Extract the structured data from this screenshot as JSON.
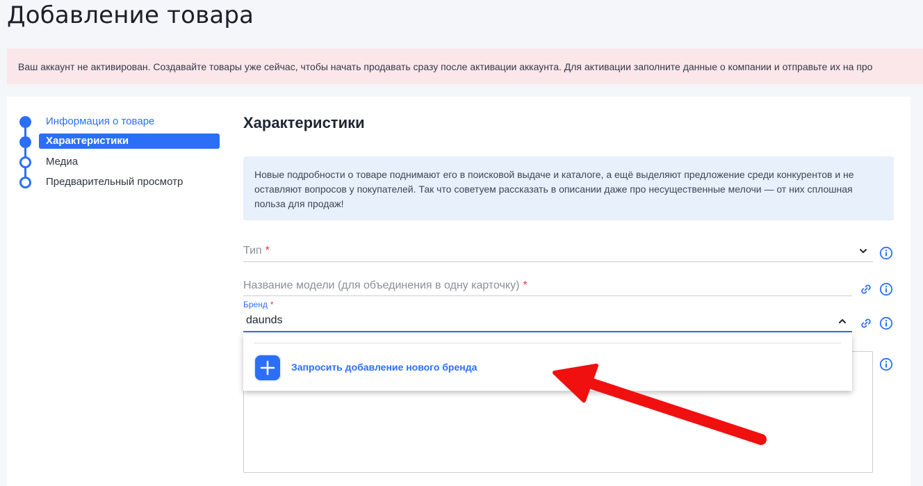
{
  "page": {
    "title": "Добавление товара"
  },
  "banner": {
    "text": "Ваш аккаунт не активирован. Создавайте товары уже сейчас, чтобы начать продавать сразу после активации аккаунта. Для активации заполните данные о компании и отправьте их на про"
  },
  "stepper": {
    "steps": [
      {
        "label": "Информация о товаре",
        "state": "completed"
      },
      {
        "label": "Характеристики",
        "state": "active"
      },
      {
        "label": "Медиа",
        "state": "pending"
      },
      {
        "label": "Предварительный просмотр",
        "state": "pending"
      }
    ]
  },
  "section": {
    "title": "Характеристики",
    "info_text": "Новые подробности о товаре поднимают его в поисковой выдаче и каталоге, а ещё выделяют предложение среди конкурентов и не оставляют вопросов у покупателей. Так что советуем рассказать в описании даже про несущественные мелочи — от них сплошная польза для продаж!"
  },
  "fields": {
    "type": {
      "placeholder": "Тип",
      "required_mark": "*"
    },
    "model_name": {
      "placeholder": "Название модели (для объединения в одну карточку)",
      "required_mark": "*"
    },
    "brand": {
      "label": "Бренд",
      "required_mark": "*",
      "value": "daunds"
    }
  },
  "dropdown": {
    "add_brand_label": "Запросить добавление нового бренда"
  },
  "icons": {
    "info": "info-icon",
    "link": "link-icon",
    "chevron_down": "chevron-down-icon",
    "chevron_up": "chevron-up-icon",
    "plus": "plus-icon"
  },
  "colors": {
    "accent": "#2b6ff6",
    "banner_bg": "#fbe6ea",
    "info_bg": "#e8f0fc",
    "required": "#e8334a",
    "annotation_arrow": "#f01010"
  }
}
